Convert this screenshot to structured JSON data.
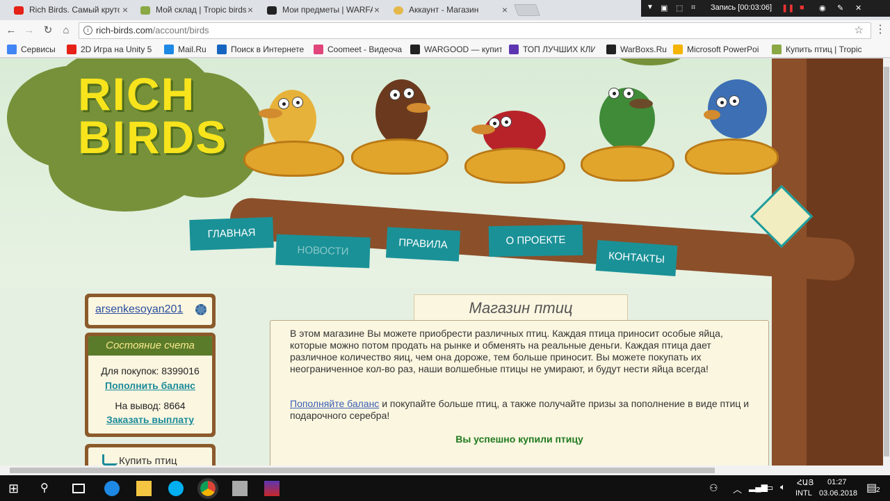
{
  "browser": {
    "tabs": [
      {
        "title": "Rich Birds. Самый крутой",
        "close": "×",
        "fav_color": "#e62117"
      },
      {
        "title": "Мой склад | Tropic birds",
        "close": "×",
        "fav_color": "#8aa844"
      },
      {
        "title": "Мои предметы | WARFA",
        "close": "×",
        "fav_color": "#222222"
      },
      {
        "title": "Аккаунт - Магазин",
        "close": "×",
        "fav_color": "#e5b84a"
      }
    ],
    "recorder": {
      "label": "Запись [00:03:06]"
    },
    "url_host": "rich-birds.com",
    "url_path": "/account/birds",
    "info_icon": "i",
    "bookmarks": [
      {
        "label": "Сервисы",
        "color": "#4285f4"
      },
      {
        "label": "2D Игра на Unity 5",
        "color": "#e62117"
      },
      {
        "label": "Mail.Ru",
        "color": "#1e88e5"
      },
      {
        "label": "Поиск в Интернете",
        "color": "#1565c0"
      },
      {
        "label": "Coomeet - Видеоча",
        "color": "#e0457b"
      },
      {
        "label": "WARGOOD — купит",
        "color": "#222222"
      },
      {
        "label": "ТОП ЛУЧШИХ КЛИ",
        "color": "#5e35b1"
      },
      {
        "label": "WarBoxs.Ru",
        "color": "#222222"
      },
      {
        "label": "Microsoft PowerPoi",
        "color": "#f4b400"
      },
      {
        "label": "Купить птиц | Tropic",
        "color": "#8aa844"
      }
    ]
  },
  "site": {
    "logo_line1": "RICH",
    "logo_line2": "BIRDS",
    "nav": [
      {
        "label": "ГЛАВНАЯ",
        "state": "active"
      },
      {
        "label": "НОВОСТИ",
        "state": "inactive"
      },
      {
        "label": "ПРАВИЛА",
        "state": "active"
      },
      {
        "label": "О ПРОЕКТЕ",
        "state": "active"
      },
      {
        "label": "КОНТАКТЫ",
        "state": "active"
      }
    ]
  },
  "sidebar": {
    "username": "arsenkesoyan201",
    "account": {
      "title": "Состояние счета",
      "purchase_label": "Для покупок: 8399016",
      "topup_link": "Пополнить баланс",
      "withdraw_label": "На вывод: 8664",
      "payout_link": "Заказать выплату"
    },
    "buy_birds": "Купить птиц"
  },
  "main": {
    "title": "Магазин птиц",
    "intro": "В этом магазине Вы можете приобрести различных птиц. Каждая птица приносит особые яйца, которые можно потом продать на рынке и обменять на реальные деньги. Каждая птица дает различное количество яиц, чем она дороже, тем больше приносит. Вы можете покупать их неограниченное кол-во раз, наши волшебные птицы не умирают, и будут нести яйца всегда!",
    "topup_link": "Пополняйте баланс",
    "topup_rest": " и покупайте больше птиц, а также получайте призы за пополнение в виде птиц и подарочного серебра!",
    "success": "Вы успешно купили птицу"
  },
  "taskbar": {
    "lang_line1": "ՀԱՅ",
    "lang_line2": "INTL",
    "time": "01:27",
    "date": "03.06.2018",
    "notifications": "2"
  }
}
